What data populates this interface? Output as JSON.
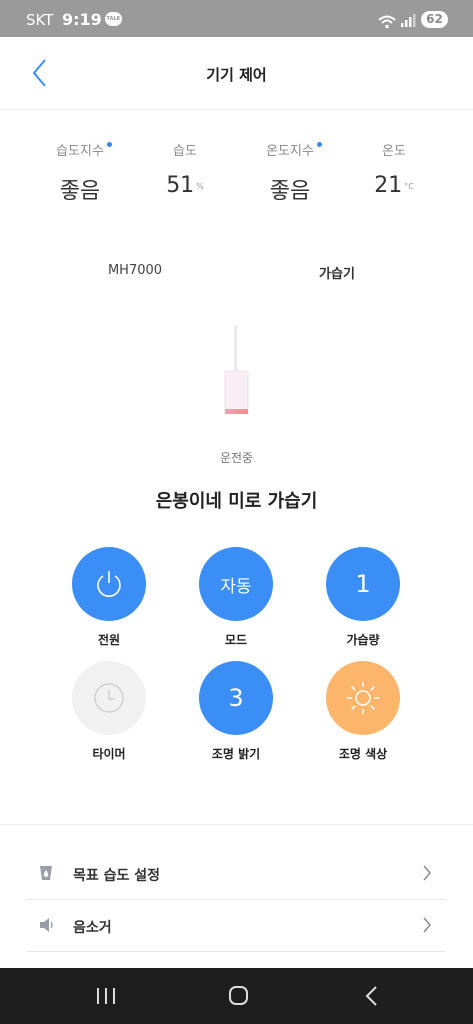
{
  "status_bar": {
    "carrier": "SKT",
    "time": "9:19",
    "talk_badge": "TALK",
    "battery": "62"
  },
  "header": {
    "title": "기기 제어"
  },
  "environment": [
    {
      "label": "습도지수",
      "value": "좋음",
      "unit": "",
      "has_dot": true
    },
    {
      "label": "습도",
      "value": "51",
      "unit": "%",
      "has_dot": false
    },
    {
      "label": "온도지수",
      "value": "좋음",
      "unit": "",
      "has_dot": true
    },
    {
      "label": "온도",
      "value": "21",
      "unit": "°C",
      "has_dot": false
    }
  ],
  "device": {
    "model": "MH7000",
    "type": "가습기",
    "status": "운전중",
    "name": "은봉이네 미로 가습기"
  },
  "controls": {
    "power": {
      "label": "전원",
      "icon": "power-icon"
    },
    "mode": {
      "label": "모드",
      "value": "자동"
    },
    "amount": {
      "label": "가습량",
      "value": "1"
    },
    "timer": {
      "label": "타이머",
      "icon": "clock-icon"
    },
    "brightness": {
      "label": "조명 밝기",
      "value": "3"
    },
    "light_color": {
      "label": "조명 색상",
      "icon": "sun-icon"
    }
  },
  "settings": [
    {
      "label": "목표 습도 설정",
      "icon": "water-drop-icon"
    },
    {
      "label": "음소거",
      "icon": "speaker-icon"
    }
  ],
  "colors": {
    "accent_blue": "#3a8ef5",
    "accent_orange": "#fdb56c",
    "status_bar": "#9a9a9a",
    "nav_bar": "#1e1e1e"
  }
}
